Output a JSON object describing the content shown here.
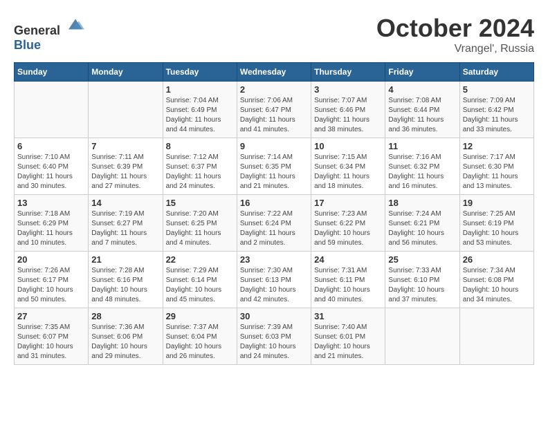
{
  "header": {
    "logo_general": "General",
    "logo_blue": "Blue",
    "month": "October 2024",
    "location": "Vrangel', Russia"
  },
  "days_of_week": [
    "Sunday",
    "Monday",
    "Tuesday",
    "Wednesday",
    "Thursday",
    "Friday",
    "Saturday"
  ],
  "weeks": [
    [
      {
        "day": "",
        "sunrise": "",
        "sunset": "",
        "daylight": ""
      },
      {
        "day": "",
        "sunrise": "",
        "sunset": "",
        "daylight": ""
      },
      {
        "day": "1",
        "sunrise": "Sunrise: 7:04 AM",
        "sunset": "Sunset: 6:49 PM",
        "daylight": "Daylight: 11 hours and 44 minutes."
      },
      {
        "day": "2",
        "sunrise": "Sunrise: 7:06 AM",
        "sunset": "Sunset: 6:47 PM",
        "daylight": "Daylight: 11 hours and 41 minutes."
      },
      {
        "day": "3",
        "sunrise": "Sunrise: 7:07 AM",
        "sunset": "Sunset: 6:46 PM",
        "daylight": "Daylight: 11 hours and 38 minutes."
      },
      {
        "day": "4",
        "sunrise": "Sunrise: 7:08 AM",
        "sunset": "Sunset: 6:44 PM",
        "daylight": "Daylight: 11 hours and 36 minutes."
      },
      {
        "day": "5",
        "sunrise": "Sunrise: 7:09 AM",
        "sunset": "Sunset: 6:42 PM",
        "daylight": "Daylight: 11 hours and 33 minutes."
      }
    ],
    [
      {
        "day": "6",
        "sunrise": "Sunrise: 7:10 AM",
        "sunset": "Sunset: 6:40 PM",
        "daylight": "Daylight: 11 hours and 30 minutes."
      },
      {
        "day": "7",
        "sunrise": "Sunrise: 7:11 AM",
        "sunset": "Sunset: 6:39 PM",
        "daylight": "Daylight: 11 hours and 27 minutes."
      },
      {
        "day": "8",
        "sunrise": "Sunrise: 7:12 AM",
        "sunset": "Sunset: 6:37 PM",
        "daylight": "Daylight: 11 hours and 24 minutes."
      },
      {
        "day": "9",
        "sunrise": "Sunrise: 7:14 AM",
        "sunset": "Sunset: 6:35 PM",
        "daylight": "Daylight: 11 hours and 21 minutes."
      },
      {
        "day": "10",
        "sunrise": "Sunrise: 7:15 AM",
        "sunset": "Sunset: 6:34 PM",
        "daylight": "Daylight: 11 hours and 18 minutes."
      },
      {
        "day": "11",
        "sunrise": "Sunrise: 7:16 AM",
        "sunset": "Sunset: 6:32 PM",
        "daylight": "Daylight: 11 hours and 16 minutes."
      },
      {
        "day": "12",
        "sunrise": "Sunrise: 7:17 AM",
        "sunset": "Sunset: 6:30 PM",
        "daylight": "Daylight: 11 hours and 13 minutes."
      }
    ],
    [
      {
        "day": "13",
        "sunrise": "Sunrise: 7:18 AM",
        "sunset": "Sunset: 6:29 PM",
        "daylight": "Daylight: 11 hours and 10 minutes."
      },
      {
        "day": "14",
        "sunrise": "Sunrise: 7:19 AM",
        "sunset": "Sunset: 6:27 PM",
        "daylight": "Daylight: 11 hours and 7 minutes."
      },
      {
        "day": "15",
        "sunrise": "Sunrise: 7:20 AM",
        "sunset": "Sunset: 6:25 PM",
        "daylight": "Daylight: 11 hours and 4 minutes."
      },
      {
        "day": "16",
        "sunrise": "Sunrise: 7:22 AM",
        "sunset": "Sunset: 6:24 PM",
        "daylight": "Daylight: 11 hours and 2 minutes."
      },
      {
        "day": "17",
        "sunrise": "Sunrise: 7:23 AM",
        "sunset": "Sunset: 6:22 PM",
        "daylight": "Daylight: 10 hours and 59 minutes."
      },
      {
        "day": "18",
        "sunrise": "Sunrise: 7:24 AM",
        "sunset": "Sunset: 6:21 PM",
        "daylight": "Daylight: 10 hours and 56 minutes."
      },
      {
        "day": "19",
        "sunrise": "Sunrise: 7:25 AM",
        "sunset": "Sunset: 6:19 PM",
        "daylight": "Daylight: 10 hours and 53 minutes."
      }
    ],
    [
      {
        "day": "20",
        "sunrise": "Sunrise: 7:26 AM",
        "sunset": "Sunset: 6:17 PM",
        "daylight": "Daylight: 10 hours and 50 minutes."
      },
      {
        "day": "21",
        "sunrise": "Sunrise: 7:28 AM",
        "sunset": "Sunset: 6:16 PM",
        "daylight": "Daylight: 10 hours and 48 minutes."
      },
      {
        "day": "22",
        "sunrise": "Sunrise: 7:29 AM",
        "sunset": "Sunset: 6:14 PM",
        "daylight": "Daylight: 10 hours and 45 minutes."
      },
      {
        "day": "23",
        "sunrise": "Sunrise: 7:30 AM",
        "sunset": "Sunset: 6:13 PM",
        "daylight": "Daylight: 10 hours and 42 minutes."
      },
      {
        "day": "24",
        "sunrise": "Sunrise: 7:31 AM",
        "sunset": "Sunset: 6:11 PM",
        "daylight": "Daylight: 10 hours and 40 minutes."
      },
      {
        "day": "25",
        "sunrise": "Sunrise: 7:33 AM",
        "sunset": "Sunset: 6:10 PM",
        "daylight": "Daylight: 10 hours and 37 minutes."
      },
      {
        "day": "26",
        "sunrise": "Sunrise: 7:34 AM",
        "sunset": "Sunset: 6:08 PM",
        "daylight": "Daylight: 10 hours and 34 minutes."
      }
    ],
    [
      {
        "day": "27",
        "sunrise": "Sunrise: 7:35 AM",
        "sunset": "Sunset: 6:07 PM",
        "daylight": "Daylight: 10 hours and 31 minutes."
      },
      {
        "day": "28",
        "sunrise": "Sunrise: 7:36 AM",
        "sunset": "Sunset: 6:06 PM",
        "daylight": "Daylight: 10 hours and 29 minutes."
      },
      {
        "day": "29",
        "sunrise": "Sunrise: 7:37 AM",
        "sunset": "Sunset: 6:04 PM",
        "daylight": "Daylight: 10 hours and 26 minutes."
      },
      {
        "day": "30",
        "sunrise": "Sunrise: 7:39 AM",
        "sunset": "Sunset: 6:03 PM",
        "daylight": "Daylight: 10 hours and 24 minutes."
      },
      {
        "day": "31",
        "sunrise": "Sunrise: 7:40 AM",
        "sunset": "Sunset: 6:01 PM",
        "daylight": "Daylight: 10 hours and 21 minutes."
      },
      {
        "day": "",
        "sunrise": "",
        "sunset": "",
        "daylight": ""
      },
      {
        "day": "",
        "sunrise": "",
        "sunset": "",
        "daylight": ""
      }
    ]
  ]
}
